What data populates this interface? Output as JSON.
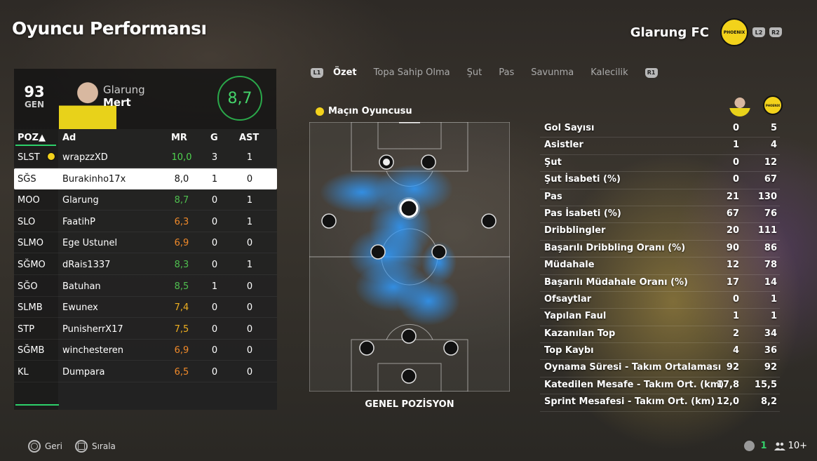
{
  "header": {
    "title": "Oyuncu Performansı",
    "club_name": "Glarung FC",
    "l2": "L2",
    "r2": "R2",
    "crest_text": "PHOENIX"
  },
  "player": {
    "ovr": "93",
    "ovr_label": "GEN",
    "first": "Glarung",
    "last": "Mert",
    "rating": "8,7"
  },
  "table": {
    "headers": {
      "poz": "POZ▲",
      "ad": "Ad",
      "mr": "MR",
      "g": "G",
      "ast": "AST"
    },
    "rows": [
      {
        "poz": "SLST",
        "ad": "wrapzzXD",
        "mr": "10,0",
        "g": "3",
        "ast": "1",
        "color": "#4fd34f",
        "motm": true
      },
      {
        "poz": "SĞS",
        "ad": "Burakinho17x",
        "mr": "8,0",
        "g": "1",
        "ast": "0",
        "color": "#111111",
        "selected": true
      },
      {
        "poz": "MOO",
        "ad": "Glarung",
        "mr": "8,7",
        "g": "0",
        "ast": "1",
        "color": "#4fbf4f"
      },
      {
        "poz": "SLO",
        "ad": "FaatihP",
        "mr": "6,3",
        "g": "0",
        "ast": "1",
        "color": "#f08a2a"
      },
      {
        "poz": "SLMO",
        "ad": "Ege Ustunel",
        "mr": "6,9",
        "g": "0",
        "ast": "0",
        "color": "#f08a2a"
      },
      {
        "poz": "SĞMO",
        "ad": "dRais1337",
        "mr": "8,3",
        "g": "0",
        "ast": "1",
        "color": "#4fbf4f"
      },
      {
        "poz": "SĞO",
        "ad": "Batuhan",
        "mr": "8,5",
        "g": "1",
        "ast": "0",
        "color": "#4fbf4f"
      },
      {
        "poz": "SLMB",
        "ad": "Ewunex",
        "mr": "7,4",
        "g": "0",
        "ast": "0",
        "color": "#f0b020"
      },
      {
        "poz": "STP",
        "ad": "PunisherrX17",
        "mr": "7,5",
        "g": "0",
        "ast": "0",
        "color": "#f0b020"
      },
      {
        "poz": "SĞMB",
        "ad": "winchesteren",
        "mr": "6,9",
        "g": "0",
        "ast": "0",
        "color": "#f08a2a"
      },
      {
        "poz": "KL",
        "ad": "Dumpara",
        "mr": "6,5",
        "g": "0",
        "ast": "0",
        "color": "#f08a2a"
      }
    ]
  },
  "tabs": {
    "l1": "L1",
    "r1": "R1",
    "items": [
      "Özet",
      "Topa Sahip Olma",
      "Şut",
      "Pas",
      "Savunma",
      "Kalecilik"
    ]
  },
  "pitch": {
    "motm_label": "Maçın Oyuncusu",
    "caption": "GENEL POZİSYON"
  },
  "stats": [
    {
      "label": "Gol Sayısı",
      "a": "0",
      "b": "5"
    },
    {
      "label": "Asistler",
      "a": "1",
      "b": "4"
    },
    {
      "label": "Şut",
      "a": "0",
      "b": "12"
    },
    {
      "label": "Şut İsabeti (%)",
      "a": "0",
      "b": "67"
    },
    {
      "label": "Pas",
      "a": "21",
      "b": "130"
    },
    {
      "label": "Pas İsabeti (%)",
      "a": "67",
      "b": "76"
    },
    {
      "label": "Dribblingler",
      "a": "20",
      "b": "111"
    },
    {
      "label": "Başarılı Dribbling Oranı (%)",
      "a": "90",
      "b": "86"
    },
    {
      "label": "Müdahale",
      "a": "12",
      "b": "78"
    },
    {
      "label": "Başarılı Müdahale Oranı (%)",
      "a": "17",
      "b": "14"
    },
    {
      "label": "Ofsaytlar",
      "a": "0",
      "b": "1"
    },
    {
      "label": "Yapılan Faul",
      "a": "1",
      "b": "1"
    },
    {
      "label": "Kazanılan Top",
      "a": "2",
      "b": "34"
    },
    {
      "label": "Top Kaybı",
      "a": "4",
      "b": "36"
    },
    {
      "label": "Oynama Süresi - Takım Ortalaması",
      "a": "92",
      "b": "92"
    },
    {
      "label": "Katedilen Mesafe - Takım Ort. (km)",
      "a": "17,8",
      "b": "15,5"
    },
    {
      "label": "Sprint Mesafesi - Takım Ort. (km)",
      "a": "12,0",
      "b": "8,2"
    }
  ],
  "footer": {
    "back": "Geri",
    "sort": "Sırala",
    "count": "1",
    "players": "10+"
  }
}
